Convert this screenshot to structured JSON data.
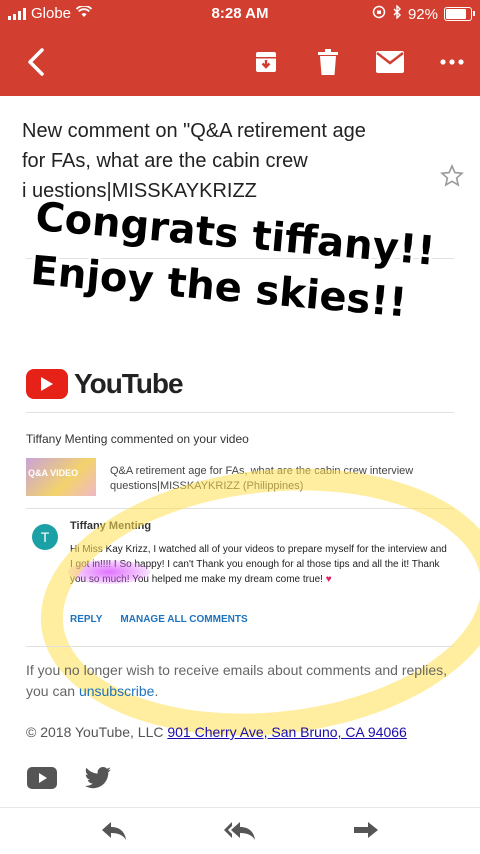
{
  "status": {
    "carrier": "Globe",
    "time": "8:28 AM",
    "battery": "92%",
    "battery_level": 0.92
  },
  "toolbar": {
    "back": "back-icon",
    "archive": "archive-icon",
    "delete": "trash-icon",
    "mark_unread": "mail-icon",
    "more": "more-icon"
  },
  "email": {
    "subject_line1": "New comment on \"Q&A retirement age",
    "subject_line2": "for FAs, what are the cabin crew",
    "subject_line3": "i          uestions|MISSKAYKRIZZ"
  },
  "overlay": {
    "line1": "Congrats tiffany!!",
    "line2": "Enjoy the skies!!"
  },
  "youtube": {
    "wordmark": "YouTube"
  },
  "notification": {
    "commented": "Tiffany Menting commented on your video",
    "thumb_text": "Q&A VIDEO",
    "video_title": "Q&A retirement age for FAs, what are the cabin crew interview questions|MISSKAYKRIZZ (Philippines)",
    "avatar_letter": "T",
    "commenter": "Tiffany Menting",
    "comment_text": "Hi Miss Kay Krizz, I watched all of your videos to prepare myself for the interview and I got in!!!! I      So happy! I can't Thank you enough for al those tips and all the                      it! Thank you so much! You helped me make my dream come true!",
    "heart": "♥",
    "reply": "REPLY",
    "manage": "MANAGE ALL COMMENTS"
  },
  "footer": {
    "unsub_prefix": "If you no longer wish to receive emails about comments and replies, you can ",
    "unsub_link": "unsubscribe",
    "unsub_suffix": ".",
    "copyright": "© 2018 YouTube, LLC ",
    "address": "901 Cherry Ave, San Bruno, CA 94066"
  },
  "bottom": {
    "reply": "reply-icon",
    "reply_all": "reply-all-icon",
    "forward": "forward-icon"
  },
  "colors": {
    "header": "#d23f31",
    "youtube_red": "#e62117",
    "link": "#1e73be",
    "highlight": "#ffe050"
  }
}
